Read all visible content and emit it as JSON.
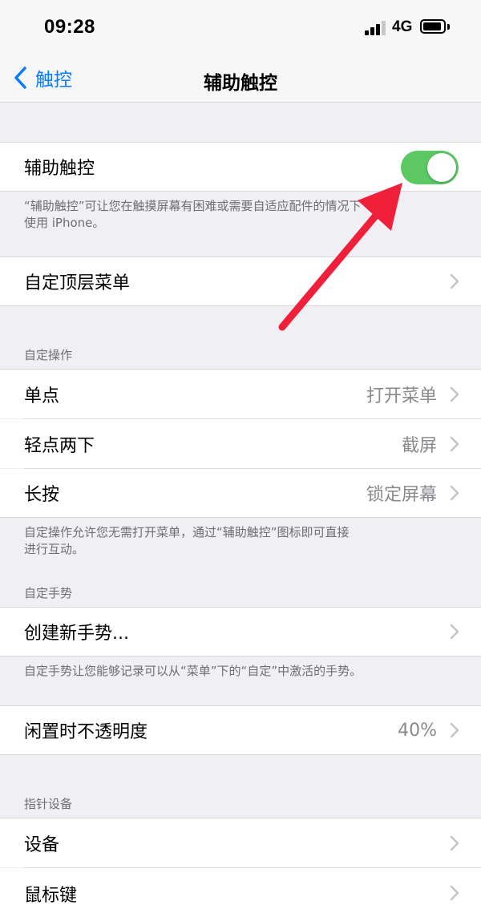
{
  "status_bar": {
    "time": "09:28",
    "network": "4G",
    "battery_level": 0.9,
    "signal_bars": 3,
    "signal_max": 4
  },
  "nav": {
    "back_label": "触控",
    "title": "辅助触控"
  },
  "assistive_touch": {
    "label": "辅助触控",
    "enabled": true,
    "toggle_color": "#5bc864",
    "footer": "“辅助触控”可让您在触摸屏幕有困难或需要自适应配件的情况下",
    "footer_line2": "使用 iPhone。"
  },
  "top_menu": {
    "label": "自定顶层菜单"
  },
  "custom_actions": {
    "header": "自定操作",
    "rows": [
      {
        "label": "单点",
        "value": "打开菜单"
      },
      {
        "label": "轻点两下",
        "value": "截屏"
      },
      {
        "label": "长按",
        "value": "锁定屏幕"
      }
    ],
    "footer": "自定操作允许您无需打开菜单，通过“辅助触控”图标即可直接",
    "footer_line2": "进行互动。"
  },
  "custom_gestures": {
    "header": "自定手势",
    "create_label": "创建新手势...",
    "footer": "自定手势让您能够记录可以从“菜单”下的“自定”中激活的手势。"
  },
  "idle_opacity": {
    "label": "闲置时不透明度",
    "value": "40%"
  },
  "pointer_devices": {
    "header": "指针设备",
    "rows": [
      {
        "label": "设备"
      },
      {
        "label": "鼠标键"
      }
    ]
  },
  "annotation": {
    "arrow_color": "#f0203a"
  }
}
